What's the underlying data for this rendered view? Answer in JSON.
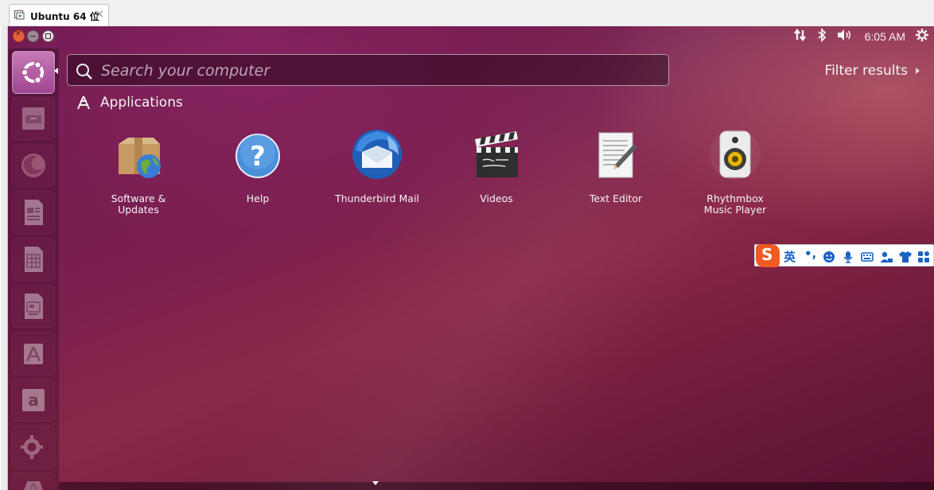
{
  "vm_tab": {
    "title": "Ubuntu 64 位",
    "close": "×"
  },
  "panel": {
    "clock": "6:05 AM"
  },
  "search": {
    "placeholder": "Search your computer",
    "value": ""
  },
  "filter": {
    "label": "Filter results"
  },
  "section": {
    "title": "Applications"
  },
  "apps": [
    {
      "label": "Software & Updates",
      "icon": "software-updates-icon"
    },
    {
      "label": "Help",
      "icon": "help-icon"
    },
    {
      "label": "Thunderbird Mail",
      "icon": "thunderbird-icon"
    },
    {
      "label": "Videos",
      "icon": "videos-icon"
    },
    {
      "label": "Text Editor",
      "icon": "text-editor-icon"
    },
    {
      "label": "Rhythmbox Music Player",
      "icon": "rhythmbox-icon"
    }
  ],
  "ime": {
    "logo": "S",
    "mode": "英",
    "punct": "•,"
  },
  "colors": {
    "accent": "#e8603a",
    "ubuntu_purple": "#772953",
    "ime_blue": "#1a62c4",
    "sogou_orange": "#f15a22"
  }
}
